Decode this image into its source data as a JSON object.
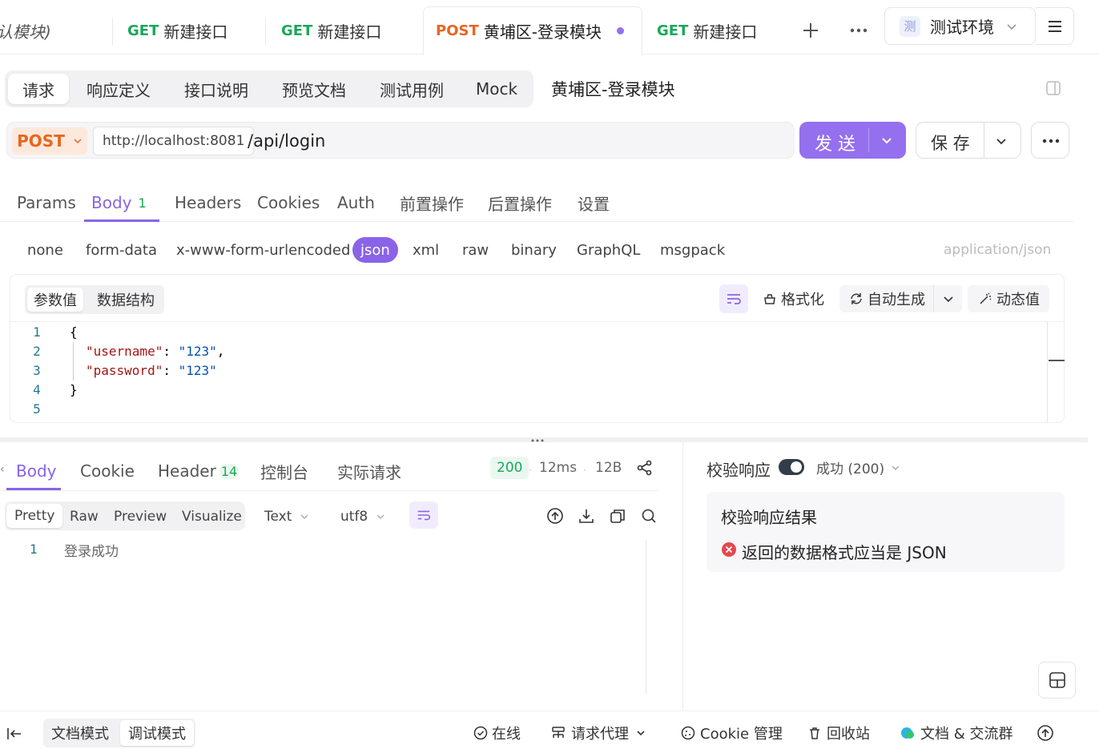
{
  "tabs": [
    {
      "method": "",
      "label": "认模块)"
    },
    {
      "method": "GET",
      "label": "新建接口"
    },
    {
      "method": "GET",
      "label": "新建接口"
    },
    {
      "method": "POST",
      "label": "黄埔区-登录模块"
    },
    {
      "method": "GET",
      "label": "新建接口"
    }
  ],
  "env": {
    "badge": "测",
    "label": "测试环境"
  },
  "subnav": {
    "items": [
      "请求",
      "响应定义",
      "接口说明",
      "预览文档",
      "测试用例",
      "Mock"
    ],
    "title": "黄埔区-登录模块"
  },
  "request": {
    "method": "POST",
    "host": "http://localhost:8081",
    "path": "/api/login",
    "send_label": "发 送",
    "save_label": "保 存"
  },
  "param_tabs": {
    "items": [
      "Params",
      "Body",
      "Headers",
      "Cookies",
      "Auth",
      "前置操作",
      "后置操作",
      "设置"
    ],
    "body_count": "1"
  },
  "body_types": {
    "items": [
      "none",
      "form-data",
      "x-www-form-urlencoded",
      "json",
      "xml",
      "raw",
      "binary",
      "GraphQL",
      "msgpack"
    ],
    "content_type": "application/json"
  },
  "editor": {
    "tabs": [
      "参数值",
      "数据结构"
    ],
    "format_label": "格式化",
    "autogen_label": "自动生成",
    "dynamic_label": "动态值",
    "line_numbers": [
      "1",
      "2",
      "3",
      "4",
      "5"
    ],
    "lines": [
      "{",
      "\"username\"",
      ": ",
      "\"123\"",
      ",",
      "\"password\"",
      ": ",
      "\"123\"",
      "}"
    ]
  },
  "response": {
    "tabs": [
      "Body",
      "Cookie",
      "Header",
      "控制台",
      "实际请求"
    ],
    "header_count": "14",
    "status": "200",
    "time": "12ms",
    "size": "12B",
    "view_tabs": [
      "Pretty",
      "Raw",
      "Preview",
      "Visualize"
    ],
    "format": "Text",
    "encoding": "utf8",
    "line_number": "1",
    "body_text": "登录成功"
  },
  "validation": {
    "label": "校验响应",
    "result_select": "成功 (200)",
    "result_title": "校验响应结果",
    "error_text": "返回的数据格式应当是 JSON"
  },
  "footer": {
    "modes": [
      "文档模式",
      "调试模式"
    ],
    "online": "在线",
    "proxy": "请求代理",
    "cookie": "Cookie 管理",
    "recycle": "回收站",
    "community": "文档 & 交流群"
  }
}
